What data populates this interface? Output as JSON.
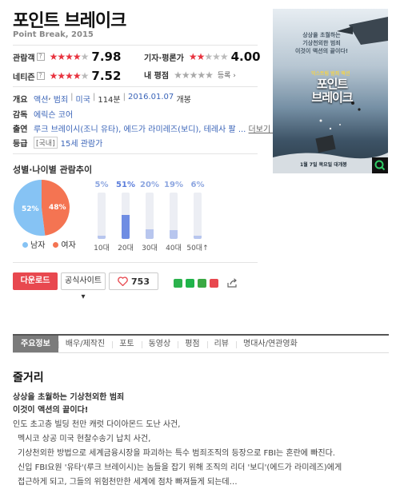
{
  "movie": {
    "title": "포인트 브레이크",
    "subtitle": "Point Break, 2015"
  },
  "ratings": {
    "audience": {
      "label": "관람객",
      "help": "?",
      "score": "7.98",
      "stars_filled": 4,
      "stars_total": 5
    },
    "critic": {
      "label": "기자·평론가",
      "score": "4.00",
      "stars_filled": 2,
      "stars_total": 5
    },
    "netizen": {
      "label": "네티즌",
      "help": "?",
      "score": "7.52",
      "stars_filled": 4,
      "stars_total": 5
    },
    "mine": {
      "label": "내 평점",
      "register": "등록 ›",
      "stars_filled": 0,
      "stars_total": 5
    }
  },
  "info": {
    "overview": {
      "label": "개요",
      "genres": [
        "액션",
        "범죄"
      ],
      "country": "미국",
      "runtime": "114분",
      "release": "2016.01.07",
      "release_suffix": "개봉"
    },
    "director": {
      "label": "감독",
      "name": "에릭슨 코어"
    },
    "cast": {
      "label": "출연",
      "line": "루크 브레이시(조니 유타), 에드가 라미레즈(보디), 테레사 팔 ...",
      "more": "더보기 ›"
    },
    "grade": {
      "label": "등급",
      "prefix": "[국내]",
      "grade": "15세 관람가"
    }
  },
  "demographics": {
    "section_title": "성별·나이별 관람추이",
    "gender": {
      "male_pct": 52,
      "female_pct": 48,
      "male_label": "52%",
      "female_label": "48%",
      "male_name": "남자",
      "female_name": "여자",
      "colors": {
        "male": "#86c3f4",
        "female": "#f47452"
      }
    },
    "ages": [
      {
        "label": "10대",
        "pct_text": "5%",
        "value": 5,
        "highlight": false
      },
      {
        "label": "20대",
        "pct_text": "51%",
        "value": 51,
        "highlight": true
      },
      {
        "label": "30대",
        "pct_text": "20%",
        "value": 20,
        "highlight": false
      },
      {
        "label": "40대",
        "pct_text": "19%",
        "value": 19,
        "highlight": false
      },
      {
        "label": "50대↑",
        "pct_text": "6%",
        "value": 6,
        "highlight": false
      }
    ]
  },
  "actions": {
    "download": "다운로드",
    "official_site": "공식사이트 ▾",
    "likes": "753",
    "sns_icons": [
      "naver-band-icon",
      "line-icon",
      "kakao-icon",
      "twitter-icon",
      "share-icon"
    ]
  },
  "tabs": [
    "주요정보",
    "배우/제작진",
    "포토",
    "동영상",
    "평점",
    "리뷰",
    "명대사/연관영화"
  ],
  "synopsis": {
    "title": "줄거리",
    "headline1": "상상을 초월하는 기상천외한 범죄",
    "headline2": "이것이 액션의 끝이다!",
    "lines": [
      "인도 초고층 빌딩 천만 캐럿 다이아몬드 도난 사건,",
      "멕시코 상공 미국 현찰수송기 납치 사건,",
      "기상천외한 방법으로 세계금융시장을 파괴하는 특수 범죄조직의 등장으로 FBI는 혼란에 빠진다.",
      "신입 FBI요원 '유타'(루크 브레이시)는 놈들을 잡기 위해 조직의 리더 '보디'(에드가 라미레즈)에게",
      "접근하게 되고, 그들의 위험천만한 세계에 점차 빠져들게 되는데…"
    ]
  },
  "poster": {
    "tagline1": "상상을 초월하는",
    "tagline2": "기상천외한 범죄",
    "tagline3": "이것이 액션의 끝이다!",
    "small_top": "익스트림 범죄 액션",
    "title_line1": "포인트",
    "title_line2": "브레이크",
    "date_text": "1월 7일 목요일 대개봉",
    "zoom_icon": "magnifier-icon"
  }
}
